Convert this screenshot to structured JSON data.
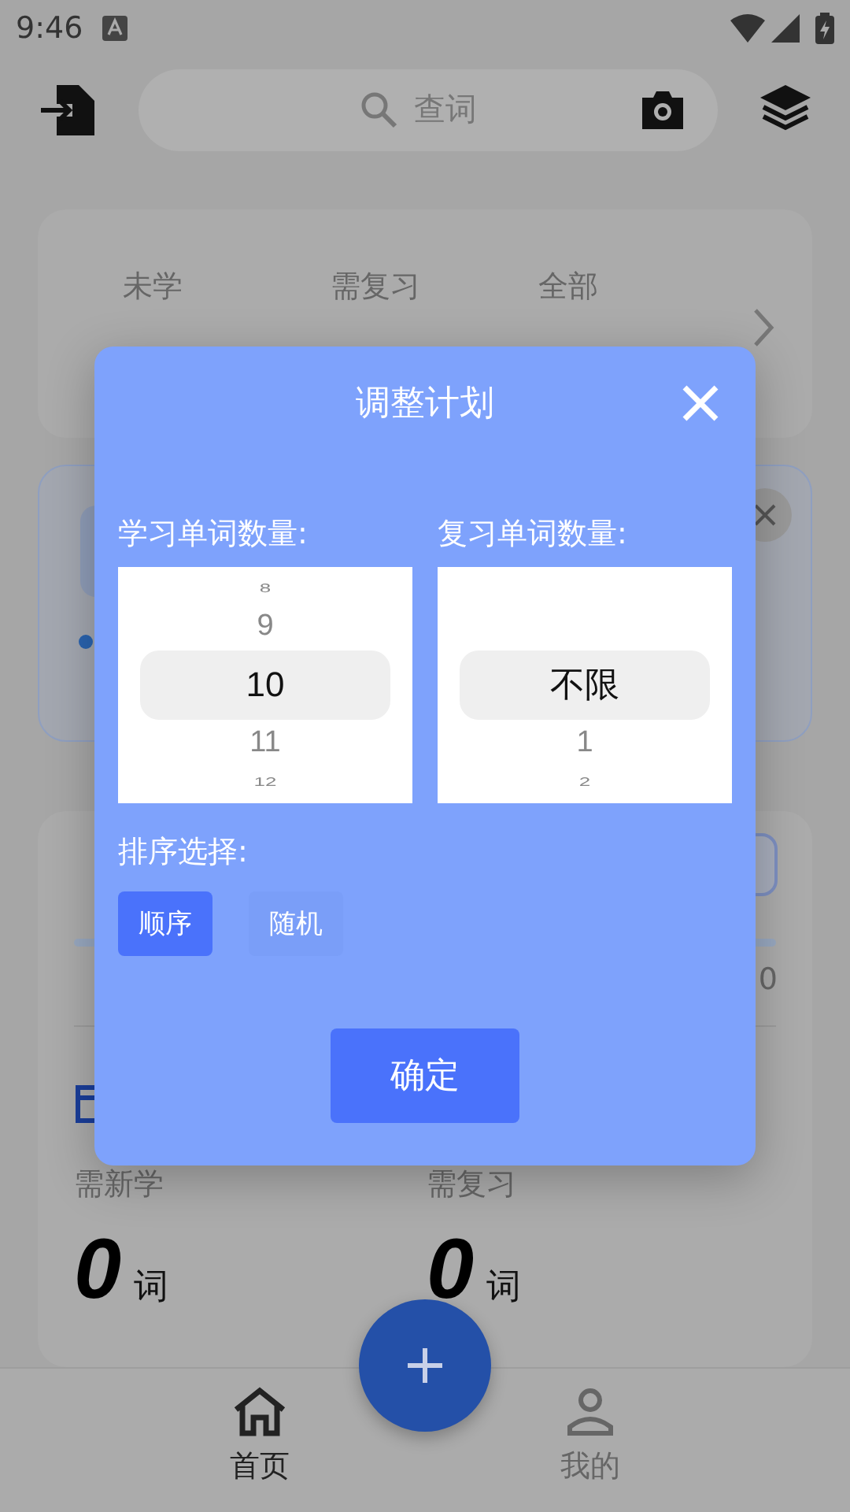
{
  "status_bar": {
    "time": "9:46"
  },
  "search": {
    "placeholder": "查词"
  },
  "stats_card": {
    "labels": [
      "未学",
      "需复习",
      "全部"
    ]
  },
  "plan_card": {
    "total": "0"
  },
  "today": [
    {
      "label": "需新学",
      "value": "0",
      "unit": "词"
    },
    {
      "label": "需复习",
      "value": "0",
      "unit": "词"
    }
  ],
  "nav": [
    {
      "label": "首页",
      "selected": true
    },
    {
      "label": "我的",
      "selected": false
    }
  ],
  "dialog": {
    "title": "调整计划",
    "pickers": [
      {
        "label": "学习单词数量:",
        "items": [
          {
            "text": "8",
            "selected": false
          },
          {
            "text": "9",
            "selected": false
          },
          {
            "text": "10",
            "selected": true
          },
          {
            "text": "11",
            "selected": false
          },
          {
            "text": "12",
            "selected": false
          }
        ]
      },
      {
        "label": "复习单词数量:",
        "items": [
          {
            "text": "不限",
            "selected": true
          },
          {
            "text": "1",
            "selected": false
          },
          {
            "text": "2",
            "selected": false
          }
        ]
      }
    ],
    "order_label": "排序选择:",
    "order_options": [
      {
        "label": "顺序",
        "selected": true
      },
      {
        "label": "随机",
        "selected": false
      }
    ],
    "confirm": "确定"
  }
}
